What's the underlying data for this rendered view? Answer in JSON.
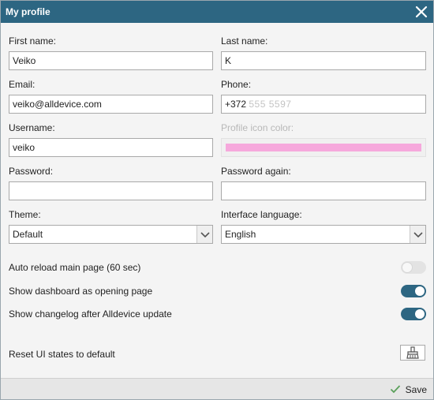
{
  "dialog": {
    "title": "My profile",
    "close_icon": "close-icon"
  },
  "form": {
    "first_name": {
      "label": "First name:",
      "value": "Veiko"
    },
    "last_name": {
      "label": "Last name:",
      "value": "K"
    },
    "email": {
      "label": "Email:",
      "value": "veiko@alldevice.com"
    },
    "phone": {
      "label": "Phone:",
      "prefix": "+372",
      "masked": "555 5597"
    },
    "username": {
      "label": "Username:",
      "value": "veiko"
    },
    "icon_color": {
      "label": "Profile icon color:",
      "color": "#f6a8dc"
    },
    "password": {
      "label": "Password:",
      "value": ""
    },
    "password_again": {
      "label": "Password again:",
      "value": ""
    },
    "theme": {
      "label": "Theme:",
      "value": "Default"
    },
    "language": {
      "label": "Interface language:",
      "value": "English"
    }
  },
  "settings": [
    {
      "label": "Auto reload main page (60 sec)",
      "enabled": false
    },
    {
      "label": "Show dashboard as opening page",
      "enabled": true
    },
    {
      "label": "Show changelog after Alldevice update",
      "enabled": true
    }
  ],
  "reset": {
    "label": "Reset UI states to default",
    "icon": "broom-icon"
  },
  "footer": {
    "save_label": "Save",
    "save_icon": "checkmark-icon"
  },
  "colors": {
    "accent": "#2d6682",
    "toggle_off": "#e3e3e3",
    "check_green": "#5aa05a"
  }
}
